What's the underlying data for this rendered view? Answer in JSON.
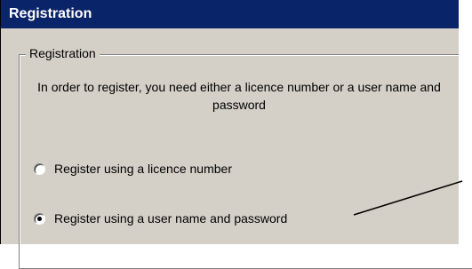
{
  "window": {
    "title": "Registration"
  },
  "group": {
    "legend": "Registration",
    "instructions": "In order to register, you need either a licence number or a user name and password"
  },
  "options": [
    {
      "label": "Register using a licence number",
      "checked": false
    },
    {
      "label": "Register using a user name and password",
      "checked": true
    }
  ]
}
